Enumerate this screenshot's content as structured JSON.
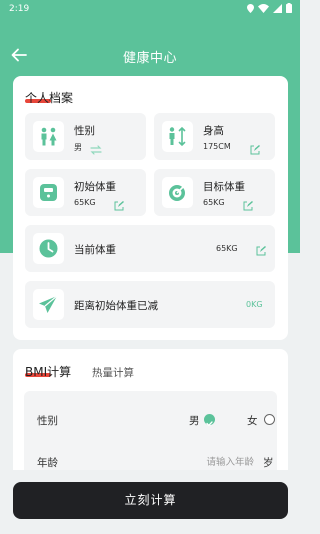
{
  "status_bar": {
    "time": "2:19"
  },
  "app_bar": {
    "title": "健康中心"
  },
  "profile_section": {
    "title": "个人档案",
    "gender": {
      "label": "性别",
      "value": "男"
    },
    "height": {
      "label": "身高",
      "value": "175CM"
    },
    "initial_weight": {
      "label": "初始体重",
      "value": "65KG"
    },
    "target_weight": {
      "label": "目标体重",
      "value": "65KG"
    },
    "current_weight": {
      "label": "当前体重",
      "value": "65KG"
    },
    "weight_lost": {
      "label": "距离初始体重已减",
      "value": "0KG"
    }
  },
  "calc_section": {
    "tabs": [
      "BMI计算",
      "热量计算"
    ],
    "active_tab": "BMI计算",
    "gender_row": {
      "label": "性别",
      "option_male": "男",
      "option_female": "女",
      "selected": "男"
    },
    "age_row": {
      "label": "年龄",
      "placeholder": "请输入年龄",
      "unit": "岁"
    }
  },
  "calc_button": {
    "label": "立刻计算"
  },
  "colors": {
    "accent_green": "#5bc29a",
    "underline_red": "#e8463a",
    "button_dark": "#202124"
  }
}
